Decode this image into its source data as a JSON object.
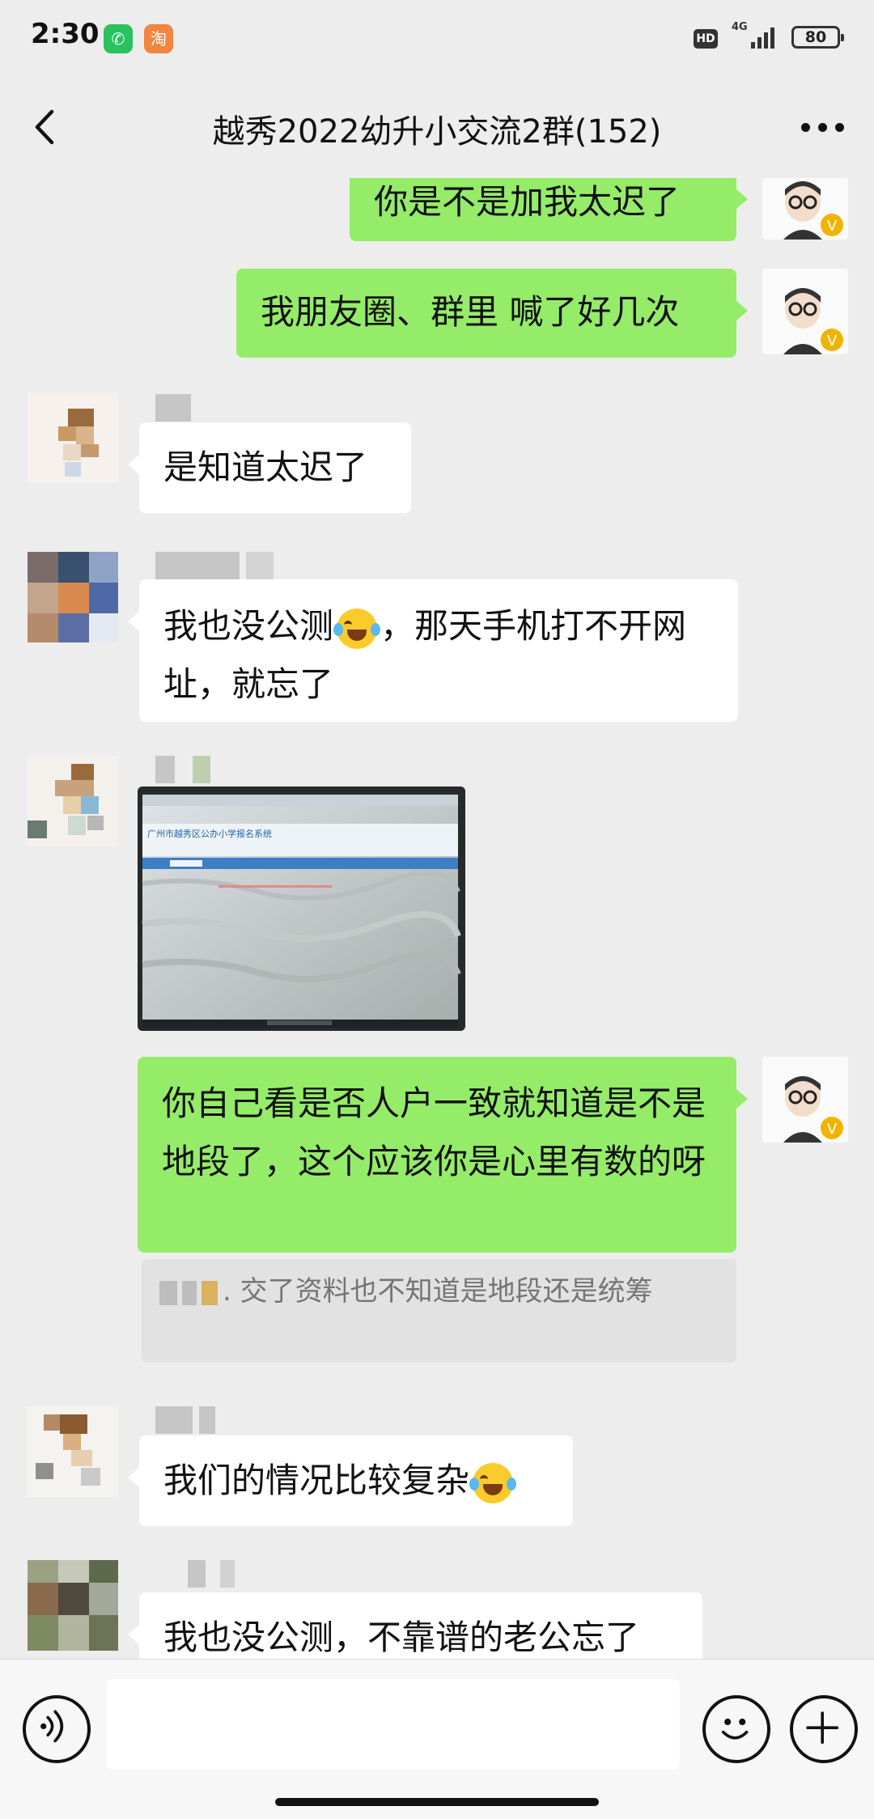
{
  "status_bar": {
    "time": "2:30",
    "hd": "HD",
    "network": "4G",
    "battery": "80",
    "apps": [
      "wechat-icon",
      "taobao-icon"
    ]
  },
  "nav": {
    "title": "越秀2022幼升小交流2群(152)",
    "icons": [
      "back-arrow-icon",
      "more-dots-icon"
    ]
  },
  "messages": [
    {
      "side": "right",
      "type": "text",
      "text": "你是不是加我太迟了"
    },
    {
      "side": "right",
      "type": "text",
      "text": "我朋友圈、群里 喊了好几次"
    },
    {
      "side": "left",
      "type": "text",
      "text": "是知道太迟了"
    },
    {
      "side": "left",
      "type": "text",
      "text_before": "我也没公测",
      "emoji": "tears-of-joy-emoji",
      "text_after": "，那天手机打不开网址，就忘了"
    },
    {
      "side": "left",
      "type": "image",
      "image_caption": "广州市越秀区公办小学报名系统"
    },
    {
      "side": "right",
      "type": "text",
      "text": "你自己看是否人户一致就知道是不是地段了，这个应该你是心里有数的呀",
      "quote": ". 交了资料也不知道是地段还是统筹"
    },
    {
      "side": "left",
      "type": "text",
      "text": "我们的情况比较复杂",
      "emoji": "crying-laughing-emoji"
    },
    {
      "side": "left",
      "type": "text",
      "text": "我也没公测，不靠谱的老公忘了"
    }
  ],
  "input": {
    "placeholder": "",
    "icons": [
      "voice-icon",
      "emoji-icon",
      "plus-icon"
    ]
  },
  "colors": {
    "background": "#ededed",
    "bubble_green": "#95ec69",
    "bubble_white": "#ffffff"
  }
}
